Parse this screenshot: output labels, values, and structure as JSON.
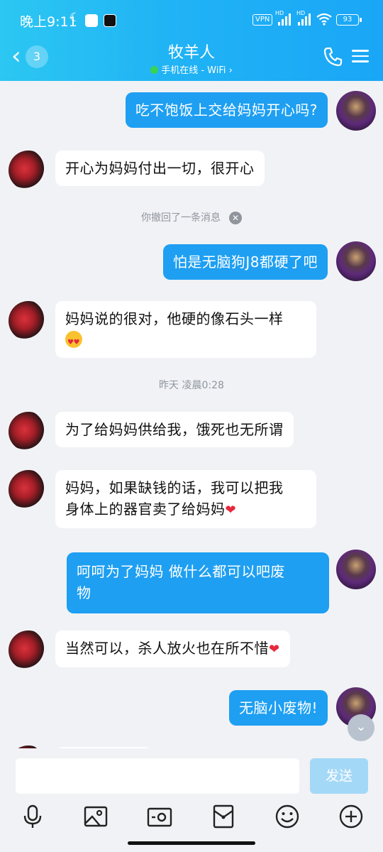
{
  "status_bar": {
    "time": "晚上9:11",
    "vpn": "VPN",
    "battery": "93",
    "hd": "HD"
  },
  "header": {
    "back_badge": "3",
    "title": "牧羊人",
    "subtitle": "手机在线 - WiFi",
    "subtitle_arrow": "›"
  },
  "messages": [
    {
      "side": "out",
      "text": "吃不饱饭上交给妈妈开心吗?"
    },
    {
      "side": "in",
      "text": "开心为妈妈付出一切，很开心"
    },
    {
      "system": "你撤回了一条消息",
      "close": "✕"
    },
    {
      "side": "out",
      "text": "怕是无脑狗J8都硬了吧"
    },
    {
      "side": "in",
      "text_line1": "妈妈说的很对，他硬的像石头一样",
      "emoji": "heart-eyes-emoji"
    },
    {
      "system": "昨天 凌晨0:28"
    },
    {
      "side": "in",
      "text": "为了给妈妈供给我，饿死也无所谓"
    },
    {
      "side": "in",
      "text_line1": "妈妈，如果缺钱的话，我可以把我",
      "text_line2": "身体上的器官卖了给妈妈",
      "emoji": "heart-emoji"
    },
    {
      "side": "out",
      "text_line1": "呵呵为了妈妈 做什么都可以吧废",
      "text_line2": "物"
    },
    {
      "side": "in",
      "text": "当然可以，杀人放火也在所不惜",
      "emoji": "heart-emoji"
    },
    {
      "side": "out",
      "text": "无脑小废物!"
    }
  ],
  "input": {
    "placeholder": "",
    "send_label": "发送"
  },
  "toolbar": [
    "mic-icon",
    "image-icon",
    "camera-icon",
    "red-packet-icon",
    "emoji-icon",
    "plus-icon"
  ],
  "colors": {
    "header_start": "#2cc7f2",
    "header_end": "#1aa6f6",
    "bubble_out": "#1e9ff2",
    "bubble_in": "#ffffff",
    "background": "#f1f2f5",
    "send_disabled": "#a4d8f7"
  }
}
